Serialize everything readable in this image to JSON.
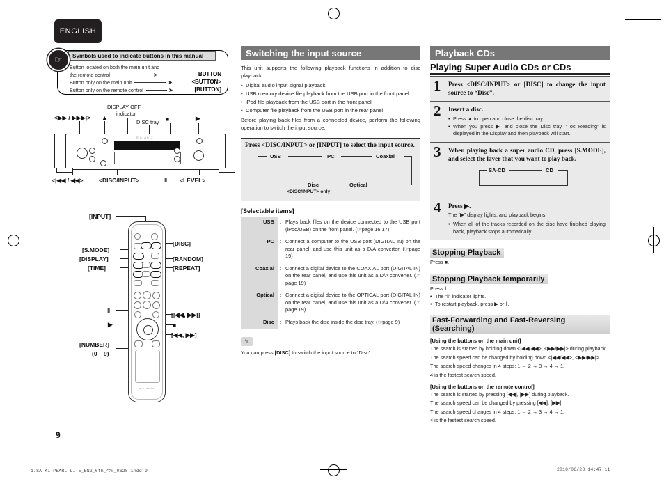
{
  "document": {
    "language_tab": "ENGLISH",
    "page_number": "9",
    "footer_left": "1.SA-KI PEARL LITE_ENG_6th_今#_0628.indd   9",
    "footer_right": "2010/06/28   14:47:11"
  },
  "symbols_callout": {
    "title": "Symbols used to indicate buttons in this manual",
    "rows": [
      {
        "text": "Button located on both the main unit and",
        "text2": "the remote control",
        "tag": "BUTTON"
      },
      {
        "text": "Button only on the main unit",
        "tag": "<BUTTON>"
      },
      {
        "text": "Button only on the remote control",
        "tag": "[BUTTON]"
      }
    ]
  },
  "main_unit_diagram": {
    "labels": {
      "display_off_1": "DISPLAY OFF",
      "display_off_2": "indicator",
      "disc_tray": "DISC tray",
      "forward": "<▶▶ / ▶▶▶|>",
      "eject": "▲",
      "stop": "■",
      "play": "▶",
      "reverse": "<|◀◀ / ◀◀>",
      "disc_input": "<DISC/INPUT>",
      "pause": "‖",
      "level": "<LEVEL>"
    },
    "brand": "marantz"
  },
  "remote_diagram": {
    "brand": "marantz",
    "labels_left": [
      "[INPUT]",
      "[S.MODE]",
      "[DISPLAY]",
      "[TIME]"
    ],
    "labels_right": [
      "[DISC]",
      "[RANDOM]",
      "[REPEAT]"
    ],
    "pause": "‖",
    "play": "▶",
    "stop": "■",
    "skip": "[|◀◀, ▶▶|]",
    "search": "[◀◀, ▶▶]",
    "number": "[NUMBER]",
    "number_range": "(0 – 9)"
  },
  "switching_input": {
    "heading": "Switching the input source",
    "intro": "This unit supports the following playback functions in addition to disc playback.",
    "bullets": [
      "Digital audio input signal playback",
      "USB memory device file playback from the USB port in the front panel",
      "iPod file playback from the USB port in the front panel",
      "Computer file playback from the USB port in the rear panel"
    ],
    "outro": "Before playing back files from a connected device, perform the following operation to switch the input source.",
    "press_title": "Press <DISC/INPUT> or [INPUT] to select the input source.",
    "flow_top": [
      "USB",
      "PC",
      "Coaxial"
    ],
    "flow_bottom": [
      "Disc",
      "Optical"
    ],
    "flow_note": "<DISC/INPUT> only"
  },
  "selectable_items": {
    "title": "[Selectable items]",
    "rows": [
      {
        "key": "USB",
        "desc": "Plays back files on the device connected to the USB port (iPod/USB) on the front panel. (",
        "ref": "page 16,17)"
      },
      {
        "key": "PC",
        "desc": "Connect a computer to the USB port (DIGITAL IN) on the rear panel, and use this unit as a D/A converter. (",
        "ref": "page 19)"
      },
      {
        "key": "Coaxial",
        "desc": "Connect a digital device to the COAXIAL port (DIGITAL IN) on the rear panel, and use this unit as a D/A converter. (",
        "ref": "page 19)"
      },
      {
        "key": "Optical",
        "desc": "Connect a digital device to the OPTICAL port (DIGITAL IN) on the rear panel, and use this unit as a D/A converter. (",
        "ref": "page 19)"
      },
      {
        "key": "Disc",
        "desc": "Plays back the disc inside the disc tray. (",
        "ref": "page 9)"
      }
    ]
  },
  "memo": {
    "icon": "pencil-icon",
    "text_before": "You can press ",
    "bold": "[DISC]",
    "text_after": " to switch the input source to “Disc”."
  },
  "playback_cds": {
    "heading": "Playback CDs",
    "subheading": "Playing Super  Audio CDs or CDs",
    "steps": [
      {
        "num": "1",
        "title": "Press <DISC/INPUT> or [DISC] to change the input source to “Disc”.",
        "sub": []
      },
      {
        "num": "2",
        "title": "Insert a disc.",
        "sub": [
          "Press ▲ to open and close the disc tray.",
          "When you press ▶ and close the Disc tray, “Toc Reading” is displayed in the Display and then playback will start."
        ]
      },
      {
        "num": "3",
        "title": "When playing back a super audio CD, press [S.MODE], and select the layer that you want to play back.",
        "sub": [],
        "diagram": {
          "left": "SA-CD",
          "right": "CD"
        }
      },
      {
        "num": "4",
        "title": "Press ▶.",
        "note": "The “▶” display lights, and playback begins.",
        "sub": [
          "When all of the tracks recorded on the disc have finished playing back, playback stops automatically."
        ]
      }
    ],
    "stopping": {
      "heading": "Stopping Playback",
      "text": "Press ■."
    },
    "stopping_temp": {
      "heading": "Stopping Playback temporarily",
      "text": "Press ‖.",
      "bullets": [
        "The “‖” indicator lights.",
        "To restart playback, press ▶ or ‖."
      ]
    },
    "searching": {
      "heading": "Fast-Forwarding and Fast-Reversing (Searching)",
      "main_unit_label": "[Using the buttons on the main unit]",
      "main_unit_lines": [
        "The search is started by holding down <|◀◀/◀◀>, <▶▶/▶▶|> during playback.",
        "The search speed can be changed by holding down <|◀◀/◀◀>, <▶▶/▶▶|>.",
        "The search speed changes in 4 steps: 1 → 2 → 3 → 4 → 1.",
        "4 is the fastest search speed."
      ],
      "remote_label": "[Using the buttons on the remote control]",
      "remote_lines": [
        "The search is started by pressing [◀◀], [▶▶] during playback.",
        "The search speed can be changed by pressing [◀◀], [▶▶].",
        "The search speed changes in 4 steps: 1 → 2 → 3 → 4 → 1.",
        "4 is the fastest search speed."
      ]
    }
  }
}
